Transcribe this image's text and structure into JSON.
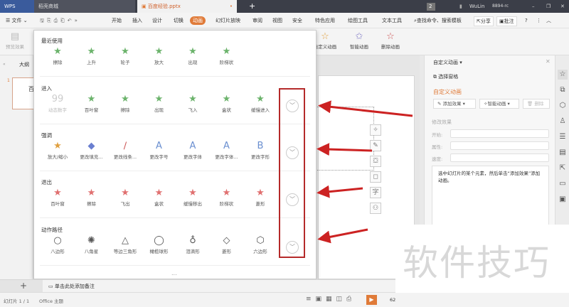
{
  "titlebar": {
    "app": "WPS",
    "tabs": [
      "稻壳商城",
      "百度经验.pptx"
    ],
    "new_tab": "+",
    "badge": "2",
    "user": "WuLin",
    "user_id": "8894-rc"
  },
  "menubar": {
    "file": "文件",
    "items": [
      "开始",
      "插入",
      "设计",
      "切换",
      "动画",
      "幻灯片放映",
      "审阅",
      "视图",
      "安全",
      "特色应用",
      "绘图工具",
      "文本工具"
    ],
    "active": "动画",
    "search": "查找命令、搜索模板",
    "share": "分享",
    "comment": "批注",
    "help": "?"
  },
  "ribbon": {
    "preview": "预览效果",
    "custom": "自定义动画",
    "smart": "智能动画",
    "delete": "删除动画"
  },
  "leftpanel": {
    "outline_tab": "大纲",
    "slide_number": "1",
    "thumb_text": "百"
  },
  "gallery": {
    "sections": [
      {
        "title": "最近使用",
        "color": "#6bb36b",
        "expand": false,
        "items": [
          {
            "label": "擦除",
            "icon": "star-wipe-icon"
          },
          {
            "label": "上升",
            "icon": "star-rise-icon"
          },
          {
            "label": "轮子",
            "icon": "star-wheel-icon"
          },
          {
            "label": "放大",
            "icon": "star-zoom-icon"
          },
          {
            "label": "出现",
            "icon": "star-appear-icon"
          },
          {
            "label": "阶梯状",
            "icon": "star-stairs-icon"
          }
        ]
      },
      {
        "title": "进入",
        "color": "#6bb36b",
        "expand": true,
        "items": [
          {
            "label": "动态数字",
            "icon": "dynamic-number-icon"
          },
          {
            "label": "百叶窗",
            "icon": "star-blinds-icon"
          },
          {
            "label": "擦除",
            "icon": "star-wipe-icon"
          },
          {
            "label": "出现",
            "icon": "star-appear-icon"
          },
          {
            "label": "飞入",
            "icon": "star-fly-in-icon"
          },
          {
            "label": "盒状",
            "icon": "star-box-icon"
          },
          {
            "label": "缓慢进入",
            "icon": "star-crawl-in-icon"
          }
        ]
      },
      {
        "title": "强调",
        "color": "#e0a040",
        "expand": true,
        "items": [
          {
            "label": "放大/缩小",
            "icon": "grow-shrink-icon"
          },
          {
            "label": "更改填充...",
            "icon": "fill-color-icon"
          },
          {
            "label": "更改线条...",
            "icon": "line-color-icon"
          },
          {
            "label": "更改字号",
            "icon": "font-size-icon"
          },
          {
            "label": "更改字体",
            "icon": "font-icon"
          },
          {
            "label": "更改字体...",
            "icon": "font-color-icon"
          },
          {
            "label": "更改字形",
            "icon": "font-style-icon"
          }
        ]
      },
      {
        "title": "退出",
        "color": "#e07070",
        "expand": true,
        "items": [
          {
            "label": "百叶窗",
            "icon": "star-blinds-exit-icon"
          },
          {
            "label": "擦除",
            "icon": "star-wipe-exit-icon"
          },
          {
            "label": "飞出",
            "icon": "star-fly-out-icon"
          },
          {
            "label": "盒状",
            "icon": "star-box-exit-icon"
          },
          {
            "label": "缓慢移出",
            "icon": "star-crawl-out-icon"
          },
          {
            "label": "阶梯状",
            "icon": "star-stairs-exit-icon"
          },
          {
            "label": "菱形",
            "icon": "star-diamond-exit-icon"
          }
        ]
      },
      {
        "title": "动作路径",
        "color": "#555555",
        "expand": true,
        "items": [
          {
            "label": "八边形",
            "icon": "octagon-path-icon"
          },
          {
            "label": "八角星",
            "icon": "star8-path-icon"
          },
          {
            "label": "等边三角形",
            "icon": "triangle-path-icon"
          },
          {
            "label": "橄榄球形",
            "icon": "football-path-icon"
          },
          {
            "label": "泪滴形",
            "icon": "teardrop-path-icon"
          },
          {
            "label": "菱形",
            "icon": "diamond-path-icon"
          },
          {
            "label": "六边形",
            "icon": "hexagon-path-icon"
          }
        ]
      }
    ],
    "more": "..."
  },
  "pane": {
    "title": "自定义动画",
    "select_pane": "选择窗格",
    "heading": "自定义动画",
    "add_effect": "添加效果",
    "smart_anim": "智能动画",
    "delete": "删除",
    "modify": "修改效果",
    "start_label": "开始:",
    "property_label": "属性:",
    "speed_label": "速度:",
    "hint": "选中幻灯片的某个元素，然后单击“添加效果”添加动画。"
  },
  "notes": {
    "placeholder": "单击此处添加备注"
  },
  "status": {
    "slide": "幻灯片 1 / 1",
    "theme": "Office 主题",
    "zoom": "62"
  },
  "watermark": "软件技巧",
  "colors": {
    "accent": "#e07b39",
    "annotation": "#cc2222",
    "titlebar": "#3b3e48"
  }
}
